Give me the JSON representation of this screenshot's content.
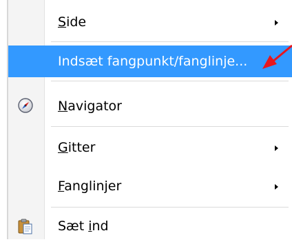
{
  "menu": {
    "items": [
      {
        "id": "side",
        "pre": "",
        "ul": "S",
        "post": "ide",
        "submenu": true,
        "highlighted": false,
        "icon": ""
      },
      {
        "id": "insert-snap",
        "pre": "",
        "ul": "",
        "post": "Indsæt fangpunkt/fanglinje...",
        "submenu": false,
        "highlighted": true,
        "icon": ""
      },
      {
        "id": "navigator",
        "pre": "",
        "ul": "N",
        "post": "avigator",
        "submenu": false,
        "highlighted": false,
        "icon": "compass-icon"
      },
      {
        "id": "gitter",
        "pre": "",
        "ul": "G",
        "post": "itter",
        "submenu": true,
        "highlighted": false,
        "icon": ""
      },
      {
        "id": "fanglinjer",
        "pre": "",
        "ul": "F",
        "post": "anglinjer",
        "submenu": true,
        "highlighted": false,
        "icon": ""
      },
      {
        "id": "paste",
        "pre": "Sæt ",
        "ul": "i",
        "post": "nd",
        "submenu": false,
        "highlighted": false,
        "icon": "paste-icon"
      }
    ]
  },
  "colors": {
    "highlight": "#3399ff",
    "annotation_arrow": "#e8161d"
  }
}
